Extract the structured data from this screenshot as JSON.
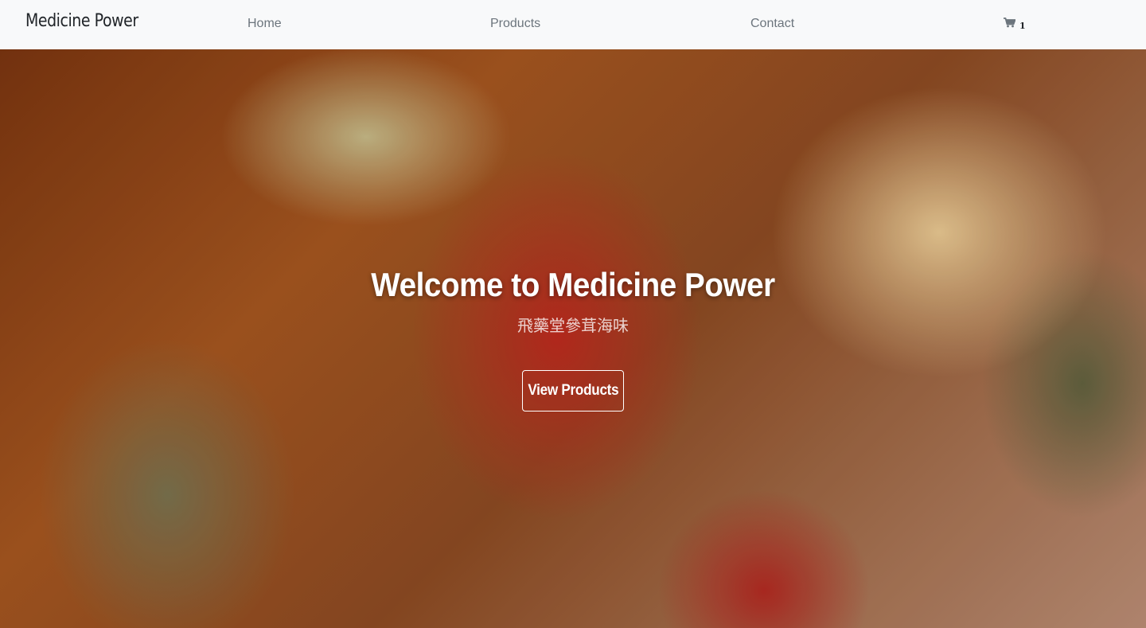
{
  "navbar": {
    "brand": "Medicine Power",
    "links": [
      {
        "label": "Home"
      },
      {
        "label": "Products"
      },
      {
        "label": "Contact"
      }
    ],
    "cart": {
      "icon": "shopping-cart-icon",
      "count": "1"
    }
  },
  "hero": {
    "title": "Welcome to Medicine Power",
    "subtitle": "飛藥堂參茸海味",
    "button_label": "View Products"
  },
  "colors": {
    "navbar_bg": "#f8f9fa",
    "nav_link": "#6c757d",
    "brand_text": "#212529",
    "hero_text": "#ffffff"
  }
}
